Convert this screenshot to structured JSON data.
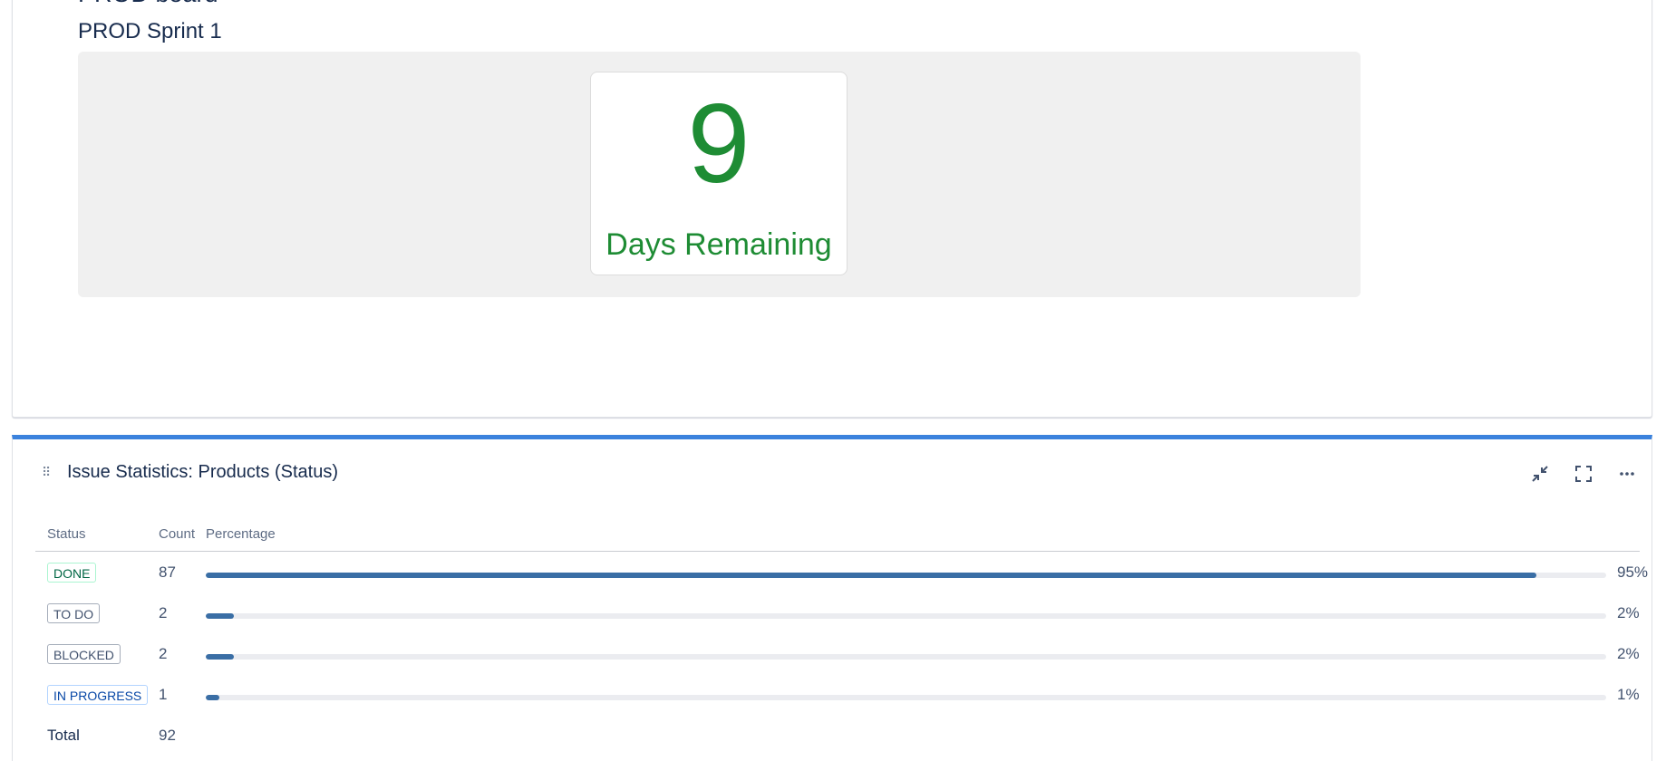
{
  "sprint_gadget": {
    "board_title": "PROD board",
    "sprint_name": "PROD Sprint 1",
    "days_remaining": "9",
    "days_label": "Days Remaining",
    "accent_color": "#1e8c34"
  },
  "stats_gadget": {
    "title": "Issue Statistics: Products (Status)",
    "accent_color": "#3b82dd",
    "actions": {
      "minimize_icon": "minimize-icon",
      "fullscreen_icon": "fullscreen-icon",
      "more_icon": "more-icon"
    },
    "headers": {
      "status": "Status",
      "count": "Count",
      "percentage": "Percentage"
    },
    "rows": [
      {
        "status": "DONE",
        "count": "87",
        "percent_label": "95%",
        "fraction": 0.95,
        "color": "#006644"
      },
      {
        "status": "TO DO",
        "count": "2",
        "percent_label": "2%",
        "fraction": 0.02,
        "color": "#42526e"
      },
      {
        "status": "BLOCKED",
        "count": "2",
        "percent_label": "2%",
        "fraction": 0.02,
        "color": "#42526e"
      },
      {
        "status": "IN PROGRESS",
        "count": "1",
        "percent_label": "1%",
        "fraction": 0.01,
        "color": "#0747a6"
      }
    ],
    "total_label": "Total",
    "total_count": "92"
  }
}
